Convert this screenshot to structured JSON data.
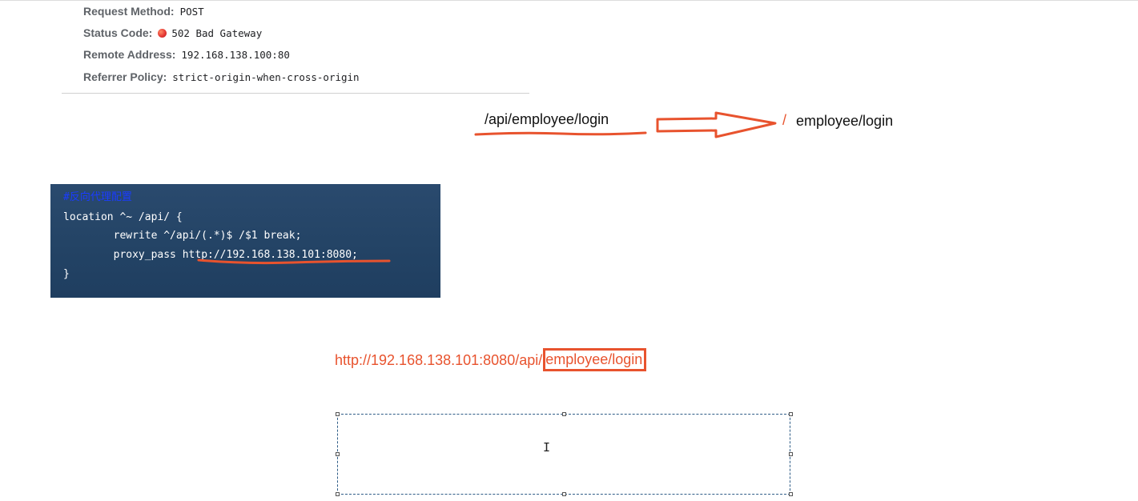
{
  "headers": [
    {
      "key": "Request Method:",
      "value": "POST"
    },
    {
      "key": "Status Code:",
      "value": "502 Bad Gateway",
      "status_color": "#e53935"
    },
    {
      "key": "Remote Address:",
      "value": "192.168.138.100:80"
    },
    {
      "key": "Referrer Policy:",
      "value": "strict-origin-when-cross-origin"
    }
  ],
  "rewrite": {
    "from": "/api/employee/login",
    "slash": "/",
    "to": "employee/login",
    "annotation_color": "#e8532e"
  },
  "code": {
    "comment": "#反向代理配置",
    "line1": "location ^~ /api/ {",
    "line2": "        rewrite ^/api/(.*)$ /$1 break;",
    "line3_prefix": "        proxy_pass ",
    "line3_url": "http://192.168.138.101:8080;",
    "line4": "}"
  },
  "full_url": {
    "prefix": "http://192.168.138.101:8080/api/",
    "highlighted": "employee/login"
  },
  "text_box": {
    "value": ""
  }
}
